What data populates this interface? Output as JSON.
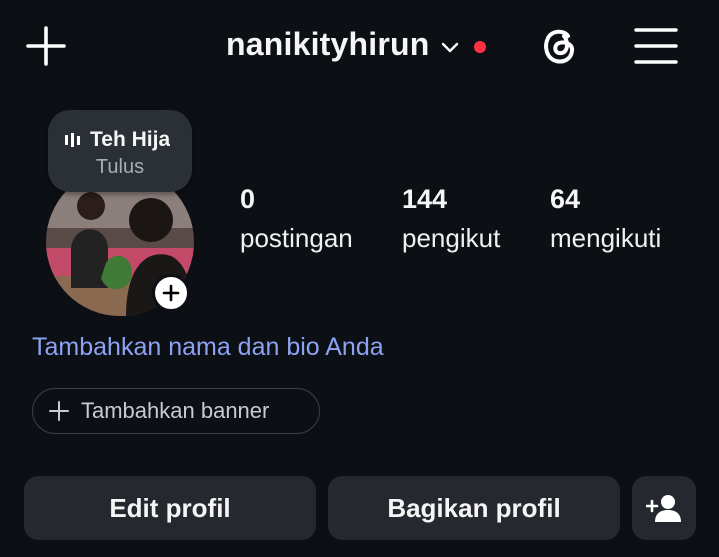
{
  "header": {
    "username": "nanikityhirun",
    "icons": [
      "plus-icon",
      "chevron-down-icon",
      "threads-icon",
      "hamburger-menu-icon"
    ],
    "notification_dot_color": "#ff3040"
  },
  "note": {
    "song_title": "Teh Hija",
    "artist": "Tulus",
    "icon": "audio-bars-icon"
  },
  "stats": [
    {
      "value": "0",
      "label": "postingan"
    },
    {
      "value": "144",
      "label": "pengikut"
    },
    {
      "value": "64",
      "label": "mengikuti"
    }
  ],
  "bio_link": "Tambahkan nama dan bio Anda",
  "banner_button": "Tambahkan banner",
  "actions": {
    "edit": "Edit profil",
    "share": "Bagikan profil",
    "add_user_icon": "add-person-icon"
  },
  "colors": {
    "background": "#0c0f14",
    "link": "#8da2f3",
    "button": "#25292f"
  }
}
